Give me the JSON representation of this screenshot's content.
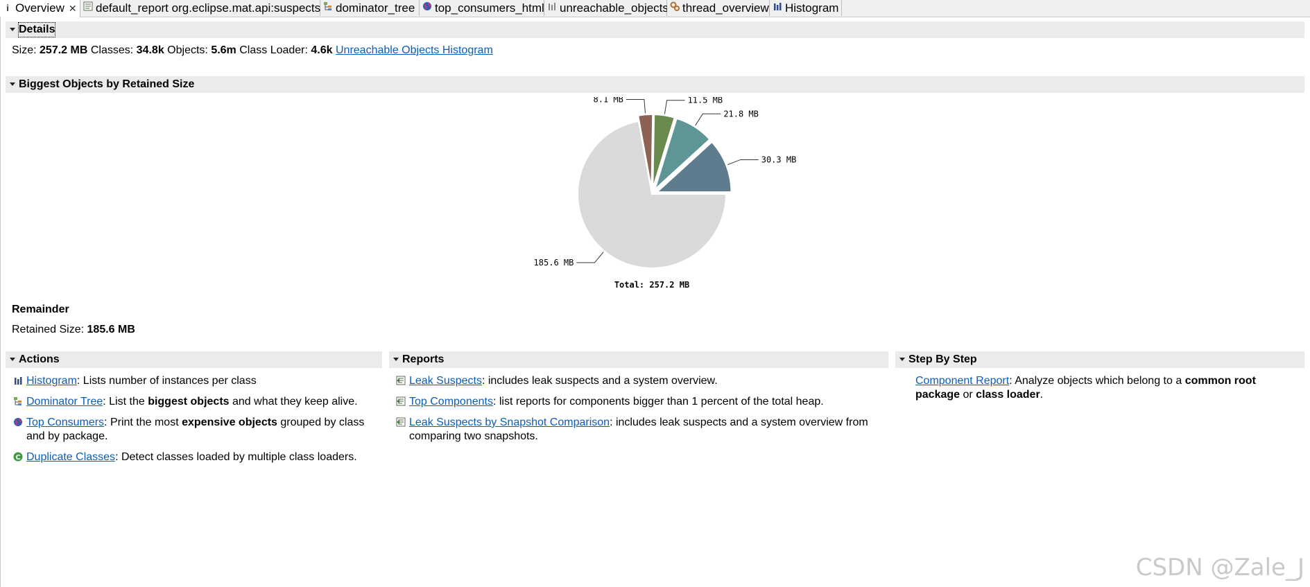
{
  "tabs": [
    {
      "label": "Overview",
      "icon": "info-icon",
      "active": true
    },
    {
      "label": "default_report org.eclipse.mat.api:suspects",
      "icon": "report-icon"
    },
    {
      "label": "dominator_tree",
      "icon": "dominator-tree-icon"
    },
    {
      "label": "top_consumers_html",
      "icon": "globe-icon"
    },
    {
      "label": "unreachable_objects",
      "icon": "histogram-icon"
    },
    {
      "label": "thread_overview",
      "icon": "threads-icon"
    },
    {
      "label": "Histogram",
      "icon": "histogram-icon"
    }
  ],
  "details": {
    "title": "Details",
    "size_label": "Size:",
    "size_value": "257.2 MB",
    "classes_label": "Classes:",
    "classes_value": "34.8k",
    "objects_label": "Objects:",
    "objects_value": "5.6m",
    "loader_label": "Class Loader:",
    "loader_value": "4.6k",
    "unreachable_link": "Unreachable Objects Histogram"
  },
  "biggest": {
    "title": "Biggest Objects by Retained Size"
  },
  "chart_data": {
    "type": "pie",
    "slices": [
      {
        "label": "30.3 MB",
        "value": 30.3,
        "color": "#5f7c8f"
      },
      {
        "label": "21.8 MB",
        "value": 21.8,
        "color": "#5f9595"
      },
      {
        "label": "11.5 MB",
        "value": 11.5,
        "color": "#6a8a4e"
      },
      {
        "label": "8.1 MB",
        "value": 8.1,
        "color": "#8b6253"
      },
      {
        "label": "185.6 MB",
        "value": 185.6,
        "color": "#dadada"
      }
    ],
    "total_label": "Total: 257.2 MB"
  },
  "remainder": {
    "title": "Remainder",
    "retained_label": "Retained Size:",
    "retained_value": "185.6 MB"
  },
  "actions": {
    "title": "Actions",
    "items": [
      {
        "link": "Histogram",
        "pre": ": Lists number of instances per class",
        "bold": "",
        "post": "",
        "icon": "histogram-icon"
      },
      {
        "link": "Dominator Tree",
        "pre": ": List the ",
        "bold": "biggest objects",
        "post": " and what they keep alive.",
        "icon": "dominator-tree-icon"
      },
      {
        "link": "Top Consumers",
        "pre": ": Print the most ",
        "bold": "expensive objects",
        "post": " grouped by class",
        "post2": "and by package.",
        "icon": "globe-icon"
      },
      {
        "link": "Duplicate Classes",
        "pre": ": Detect classes loaded by multiple class loaders.",
        "bold": "",
        "post": "",
        "icon": "duplicate-classes-icon"
      }
    ]
  },
  "reports": {
    "title": "Reports",
    "items": [
      {
        "link": "Leak Suspects",
        "text": ": includes leak suspects and a system overview.",
        "icon": "report-icon"
      },
      {
        "link": "Top Components",
        "text": ": list reports for components bigger than 1 percent of the total heap.",
        "icon": "report-icon"
      },
      {
        "link": "Leak Suspects by Snapshot Comparison",
        "text": ": includes leak suspects and a system overview from",
        "text2": "comparing two snapshots.",
        "icon": "report-icon"
      }
    ]
  },
  "stepbystep": {
    "title": "Step By Step",
    "link": "Component Report",
    "text1": ": Analyze objects which belong to a ",
    "bold1": "common root",
    "bold2": "package",
    "text2": " or ",
    "bold3": "class loader",
    "text3": "."
  },
  "watermark": "CSDN @Zale_J"
}
